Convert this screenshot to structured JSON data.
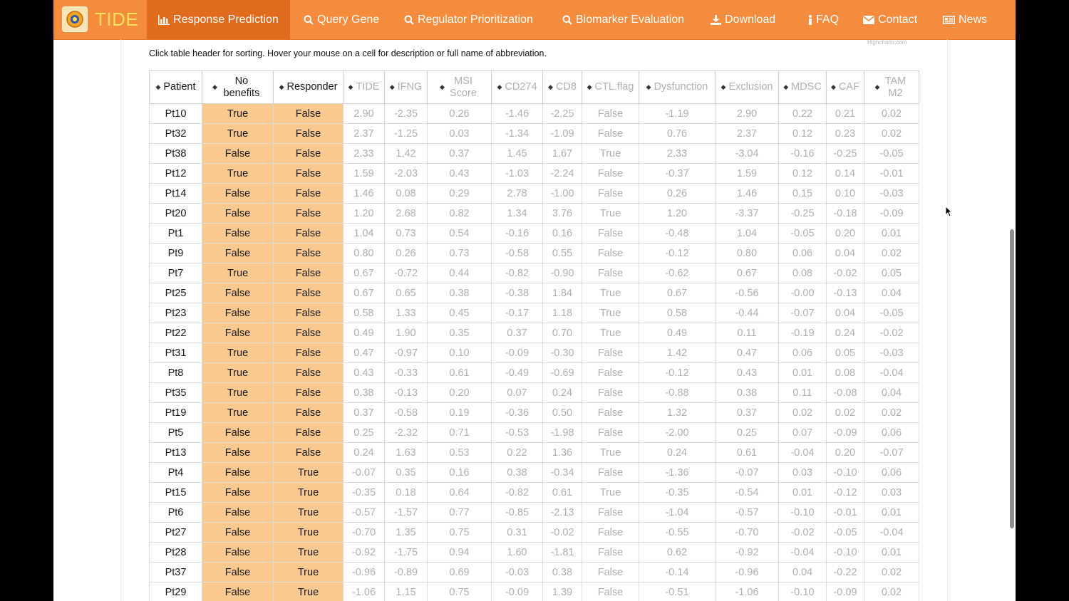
{
  "navbar": {
    "brand": "TIDE",
    "items": [
      {
        "label": "Response Prediction",
        "icon": "bar-chart-icon"
      },
      {
        "label": "Query Gene",
        "icon": "search-icon"
      },
      {
        "label": "Regulator Prioritization",
        "icon": "search-icon"
      },
      {
        "label": "Biomarker Evaluation",
        "icon": "search-icon"
      },
      {
        "label": "Download",
        "icon": "download-icon"
      },
      {
        "label": "FAQ",
        "icon": "info-icon"
      },
      {
        "label": "Contact",
        "icon": "envelope-icon"
      },
      {
        "label": "News",
        "icon": "newspaper-icon"
      }
    ],
    "active": "Response Prediction",
    "colors": {
      "bar": "#f58b3c",
      "active": "#e06b1c",
      "brand_text": "#ffe05a"
    }
  },
  "instructions": "Click table header for sorting. Hover your mouse on a cell for description or full name of abbreviation.",
  "credits": "Highcharts.com",
  "table": {
    "highlight_color": "#f9c98f",
    "headers": [
      {
        "label": "Patient",
        "sortable": true
      },
      {
        "label": "No benefits",
        "sortable": true
      },
      {
        "label": "Responder",
        "sortable": true
      },
      {
        "label": "TIDE",
        "sortable": true
      },
      {
        "label": "IFNG",
        "sortable": true
      },
      {
        "label": "MSI Score",
        "sortable": true
      },
      {
        "label": "CD274",
        "sortable": true
      },
      {
        "label": "CD8",
        "sortable": true
      },
      {
        "label": "CTL.flag",
        "sortable": true
      },
      {
        "label": "Dysfunction",
        "sortable": true
      },
      {
        "label": "Exclusion",
        "sortable": true
      },
      {
        "label": "MDSC",
        "sortable": true
      },
      {
        "label": "CAF",
        "sortable": true
      },
      {
        "label": "TAM M2",
        "sortable": true
      }
    ],
    "rows": [
      [
        "Pt10",
        "True",
        "False",
        "2.90",
        "-2.35",
        "0.26",
        "-1.46",
        "-2.25",
        "False",
        "-1.19",
        "2.90",
        "0.22",
        "0.21",
        "0.02"
      ],
      [
        "Pt32",
        "True",
        "False",
        "2.37",
        "-1.25",
        "0.03",
        "-1.34",
        "-1.09",
        "False",
        "0.76",
        "2.37",
        "0.12",
        "0.23",
        "0.02"
      ],
      [
        "Pt38",
        "False",
        "False",
        "2.33",
        "1.42",
        "0.37",
        "1.45",
        "1.67",
        "True",
        "2.33",
        "-3.04",
        "-0.16",
        "-0.25",
        "-0.05"
      ],
      [
        "Pt12",
        "True",
        "False",
        "1.59",
        "-2.03",
        "0.43",
        "-1.03",
        "-2.24",
        "False",
        "-0.37",
        "1.59",
        "0.12",
        "0.14",
        "-0.01"
      ],
      [
        "Pt14",
        "False",
        "False",
        "1.46",
        "0.08",
        "0.29",
        "2.78",
        "-1.00",
        "False",
        "0.26",
        "1.46",
        "0.15",
        "0.10",
        "-0.03"
      ],
      [
        "Pt20",
        "False",
        "False",
        "1.20",
        "2.68",
        "0.82",
        "1.34",
        "3.76",
        "True",
        "1.20",
        "-3.37",
        "-0.25",
        "-0.18",
        "-0.09"
      ],
      [
        "Pt1",
        "False",
        "False",
        "1.04",
        "0.73",
        "0.54",
        "-0.16",
        "0.16",
        "False",
        "-0.48",
        "1.04",
        "-0.05",
        "0.20",
        "0.01"
      ],
      [
        "Pt9",
        "False",
        "False",
        "0.80",
        "0.26",
        "0.73",
        "-0.58",
        "0.55",
        "False",
        "-0.12",
        "0.80",
        "0.06",
        "0.04",
        "0.02"
      ],
      [
        "Pt7",
        "True",
        "False",
        "0.67",
        "-0.72",
        "0.44",
        "-0.82",
        "-0.90",
        "False",
        "-0.62",
        "0.67",
        "0.08",
        "-0.02",
        "0.05"
      ],
      [
        "Pt25",
        "False",
        "False",
        "0.67",
        "0.65",
        "0.38",
        "-0.38",
        "1.84",
        "True",
        "0.67",
        "-0.56",
        "-0.00",
        "-0.13",
        "0.04"
      ],
      [
        "Pt23",
        "False",
        "False",
        "0.58",
        "1.33",
        "0.45",
        "-0.17",
        "1.18",
        "True",
        "0.58",
        "-0.44",
        "-0.07",
        "0.04",
        "-0.05"
      ],
      [
        "Pt22",
        "False",
        "False",
        "0.49",
        "1.90",
        "0.35",
        "0.37",
        "0.70",
        "True",
        "0.49",
        "0.11",
        "-0.19",
        "0.24",
        "-0.02"
      ],
      [
        "Pt31",
        "True",
        "False",
        "0.47",
        "-0.97",
        "0.10",
        "-0.09",
        "-0.30",
        "False",
        "1.42",
        "0.47",
        "0.06",
        "0.05",
        "-0.03"
      ],
      [
        "Pt8",
        "True",
        "False",
        "0.43",
        "-0.33",
        "0.61",
        "-0.49",
        "-0.69",
        "False",
        "-0.12",
        "0.43",
        "0.01",
        "0.08",
        "-0.04"
      ],
      [
        "Pt35",
        "True",
        "False",
        "0.38",
        "-0.13",
        "0.20",
        "0.07",
        "0.24",
        "False",
        "-0.88",
        "0.38",
        "0.11",
        "-0.08",
        "0.04"
      ],
      [
        "Pt19",
        "True",
        "False",
        "0.37",
        "-0.58",
        "0.19",
        "-0.36",
        "0.50",
        "False",
        "1.32",
        "0.37",
        "0.02",
        "0.02",
        "0.02"
      ],
      [
        "Pt5",
        "False",
        "False",
        "0.25",
        "-2.32",
        "0.71",
        "-0.53",
        "-1.98",
        "False",
        "-2.00",
        "0.25",
        "0.07",
        "-0.09",
        "0.06"
      ],
      [
        "Pt13",
        "False",
        "False",
        "0.24",
        "1.63",
        "0.53",
        "0.22",
        "1.36",
        "True",
        "0.24",
        "0.61",
        "-0.04",
        "0.20",
        "-0.07"
      ],
      [
        "Pt4",
        "False",
        "True",
        "-0.07",
        "0.35",
        "0.16",
        "0.38",
        "-0.34",
        "False",
        "-1.36",
        "-0.07",
        "0.03",
        "-0.10",
        "0.06"
      ],
      [
        "Pt15",
        "False",
        "True",
        "-0.35",
        "0.18",
        "0.64",
        "-0.82",
        "0.61",
        "True",
        "-0.35",
        "-0.54",
        "0.01",
        "-0.12",
        "0.03"
      ],
      [
        "Pt6",
        "False",
        "True",
        "-0.57",
        "-1.57",
        "0.77",
        "-0.85",
        "-2.13",
        "False",
        "-1.04",
        "-0.57",
        "-0.10",
        "-0.01",
        "0.01"
      ],
      [
        "Pt27",
        "False",
        "True",
        "-0.70",
        "1.35",
        "0.75",
        "0.31",
        "-0.02",
        "False",
        "-0.55",
        "-0.70",
        "-0.02",
        "-0.05",
        "-0.04"
      ],
      [
        "Pt28",
        "False",
        "True",
        "-0.92",
        "-1.75",
        "0.94",
        "1.60",
        "-1.81",
        "False",
        "0.62",
        "-0.92",
        "-0.04",
        "-0.10",
        "0.01"
      ],
      [
        "Pt37",
        "False",
        "True",
        "-0.96",
        "-0.89",
        "0.69",
        "-0.03",
        "0.38",
        "False",
        "-0.14",
        "-0.96",
        "0.04",
        "-0.22",
        "0.02"
      ],
      [
        "Pt29",
        "False",
        "True",
        "-1.06",
        "1.15",
        "0.75",
        "-0.09",
        "1.39",
        "False",
        "-0.51",
        "-1.06",
        "-0.10",
        "-0.09",
        "0.02"
      ]
    ]
  }
}
